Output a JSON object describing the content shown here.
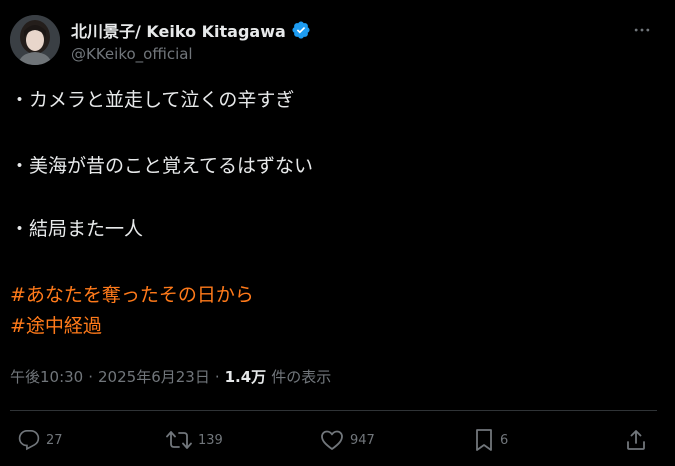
{
  "author": {
    "display_name": "北川景子/ Keiko Kitagawa",
    "handle": "@KKeiko_official"
  },
  "body_lines": [
    "・カメラと並走して泣くの辛すぎ",
    "・美海が昔のこと覚えてるはずない",
    "・結局また一人"
  ],
  "hashtags": [
    "#あなたを奪ったその日から",
    "#途中経過"
  ],
  "meta": {
    "time": "午後10:30",
    "separator": "·",
    "date": "2025年6月23日",
    "views_count": "1.4万",
    "views_label": "件の表示"
  },
  "actions": {
    "reply_count": "27",
    "retweet_count": "139",
    "like_count": "947",
    "bookmark_count": "6"
  },
  "colors": {
    "background": "#000000",
    "text": "#e7e9ea",
    "muted": "#71767b",
    "hashtag": "#ff7a1a",
    "verified": "#1d9bf0"
  },
  "icons": [
    "avatar",
    "verified-badge-icon",
    "more-icon",
    "reply-icon",
    "retweet-icon",
    "like-icon",
    "bookmark-icon",
    "share-icon"
  ]
}
